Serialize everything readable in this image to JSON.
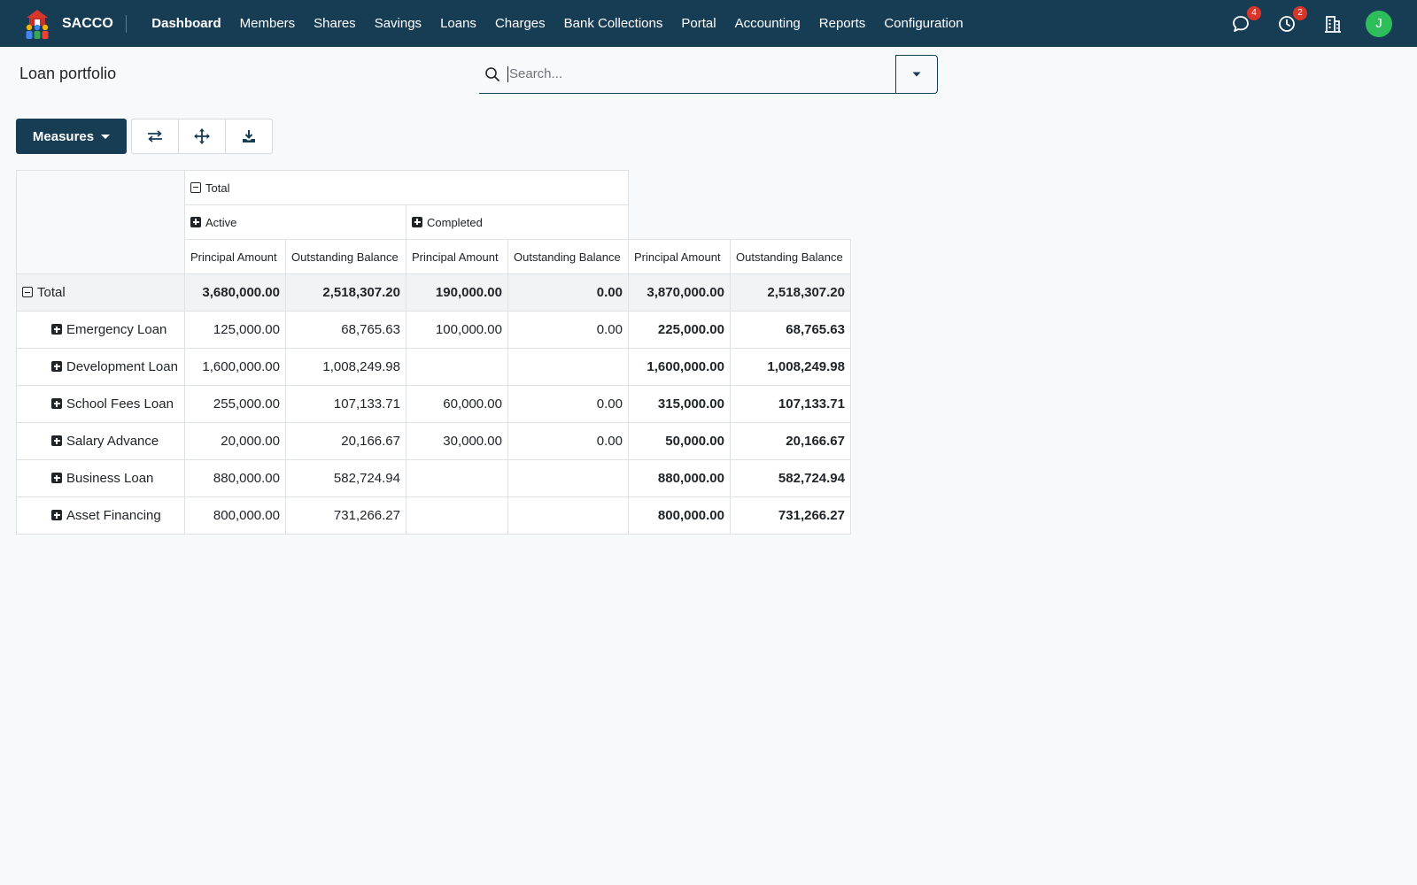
{
  "app": {
    "name": "SACCO"
  },
  "nav": [
    {
      "label": "Dashboard",
      "active": true
    },
    {
      "label": "Members"
    },
    {
      "label": "Shares"
    },
    {
      "label": "Savings"
    },
    {
      "label": "Loans"
    },
    {
      "label": "Charges"
    },
    {
      "label": "Bank Collections"
    },
    {
      "label": "Portal"
    },
    {
      "label": "Accounting"
    },
    {
      "label": "Reports"
    },
    {
      "label": "Configuration"
    }
  ],
  "topbar": {
    "messages_count": "4",
    "activities_count": "2",
    "avatar_initial": "J"
  },
  "page": {
    "title": "Loan portfolio"
  },
  "search": {
    "placeholder": "Search..."
  },
  "toolbar": {
    "measures_label": "Measures"
  },
  "pivot": {
    "col_total_label": "Total",
    "col_groups": [
      "Active",
      "Completed"
    ],
    "measures": [
      "Principal Amount",
      "Outstanding Balance",
      "Principal Amount",
      "Outstanding Balance",
      "Principal Amount",
      "Outstanding Balance"
    ],
    "total_row": {
      "label": "Total",
      "values": [
        "3,680,000.00",
        "2,518,307.20",
        "190,000.00",
        "0.00",
        "3,870,000.00",
        "2,518,307.20"
      ]
    },
    "rows": [
      {
        "label": "Emergency Loan",
        "values": [
          "125,000.00",
          "68,765.63",
          "100,000.00",
          "0.00",
          "225,000.00",
          "68,765.63"
        ]
      },
      {
        "label": "Development Loan",
        "values": [
          "1,600,000.00",
          "1,008,249.98",
          "",
          "",
          "1,600,000.00",
          "1,008,249.98"
        ]
      },
      {
        "label": "School Fees Loan",
        "values": [
          "255,000.00",
          "107,133.71",
          "60,000.00",
          "0.00",
          "315,000.00",
          "107,133.71"
        ]
      },
      {
        "label": "Salary Advance",
        "values": [
          "20,000.00",
          "20,166.67",
          "30,000.00",
          "0.00",
          "50,000.00",
          "20,166.67"
        ]
      },
      {
        "label": "Business Loan",
        "values": [
          "880,000.00",
          "582,724.94",
          "",
          "",
          "880,000.00",
          "582,724.94"
        ]
      },
      {
        "label": "Asset Financing",
        "values": [
          "800,000.00",
          "731,266.27",
          "",
          "",
          "800,000.00",
          "731,266.27"
        ]
      }
    ]
  },
  "colors": {
    "primary": "#173d55",
    "badge": "#d9362b",
    "avatar": "#2ebd5b"
  }
}
